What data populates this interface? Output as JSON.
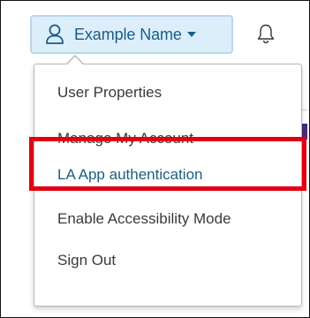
{
  "header": {
    "user_name": "Example Name",
    "user_icon": "user-icon",
    "caret_icon": "caret-down-icon",
    "bell_icon": "bell-icon"
  },
  "menu": {
    "items": [
      {
        "label": "User Properties"
      },
      {
        "label": "Manage My Account"
      },
      {
        "label": "LA App authentication",
        "highlighted": true
      },
      {
        "label": "Enable Accessibility Mode"
      },
      {
        "label": "Sign Out"
      }
    ]
  },
  "colors": {
    "accent_text": "#1a5e83",
    "button_bg": "#ddeefb",
    "button_border": "#b9d6ee",
    "highlight_border": "#e00012",
    "menu_text": "#3a3a3a"
  }
}
